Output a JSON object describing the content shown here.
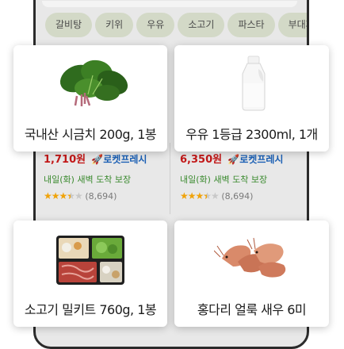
{
  "categories": [
    "갈비탕",
    "키위",
    "우유",
    "소고기",
    "파스타",
    "부대찌개"
  ],
  "cards": [
    {
      "title": "국내산 시금치 200g, 1봉",
      "image": "spinach-image"
    },
    {
      "title": "우유 1등급 2300ml, 1개",
      "image": "milk-bottle-image"
    },
    {
      "title": "소고기 밀키트 760g, 1봉",
      "image": "beef-mealkit-image"
    },
    {
      "title": "홍다리 얼룩 새우 6미",
      "image": "shrimp-image"
    }
  ],
  "behind_items": [
    {
      "price": "1,710원",
      "rocket_label": "로켓프레시",
      "delivery": "내일(화) 새벽 도착 보장",
      "rating": 3.5,
      "review_count": "(8,694)"
    },
    {
      "price": "6,350원",
      "rocket_label": "로켓프레시",
      "delivery": "내일(화) 새벽 도착 보장",
      "rating": 3.5,
      "review_count": "(8,694)"
    }
  ],
  "colors": {
    "price": "#c21818",
    "rocket": "#1a5fb4",
    "delivery": "#3a8a2e",
    "star": "#f0a30a",
    "chip": "#d3d9c7"
  }
}
